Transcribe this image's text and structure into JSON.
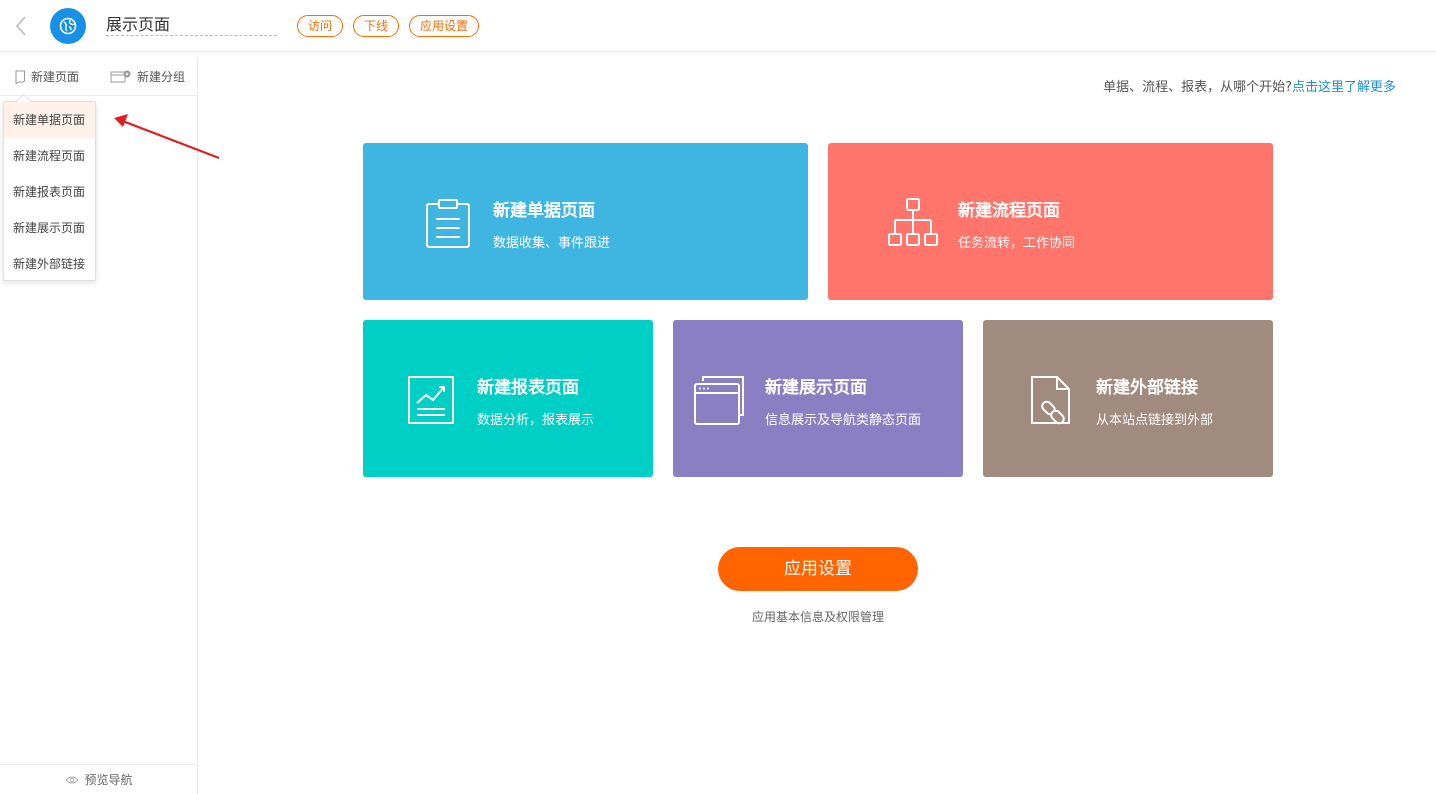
{
  "header": {
    "page_title": "展示页面",
    "tags": {
      "visit": "访问",
      "offline": "下线",
      "settings": "应用设置"
    }
  },
  "sidebar": {
    "new_page": "新建页面",
    "new_group": "新建分组",
    "dropdown": [
      "新建单据页面",
      "新建流程页面",
      "新建报表页面",
      "新建展示页面",
      "新建外部链接"
    ],
    "preview_nav": "预览导航"
  },
  "main": {
    "help_text": "单据、流程、报表，从哪个开始?",
    "help_link": "点击这里了解更多",
    "cards": [
      {
        "title": "新建单据页面",
        "subtitle": "数据收集、事件跟进",
        "icon": "clipboard-icon",
        "color": "#3fb6e1"
      },
      {
        "title": "新建流程页面",
        "subtitle": "任务流转，工作协同",
        "icon": "org-chart-icon",
        "color": "#ff756b"
      },
      {
        "title": "新建报表页面",
        "subtitle": "数据分析，报表展示",
        "icon": "chart-icon",
        "color": "#00cfc6"
      },
      {
        "title": "新建展示页面",
        "subtitle": "信息展示及导航类静态页面",
        "icon": "browser-window-icon",
        "color": "#8b7fc4"
      },
      {
        "title": "新建外部链接",
        "subtitle": "从本站点链接到外部",
        "icon": "document-link-icon",
        "color": "#a08b7e"
      }
    ],
    "settings_button": "应用设置",
    "settings_desc": "应用基本信息及权限管理"
  },
  "colors": {
    "accent": "#ff6400",
    "link": "#1c8fd6",
    "app_icon": "#1890e6"
  }
}
